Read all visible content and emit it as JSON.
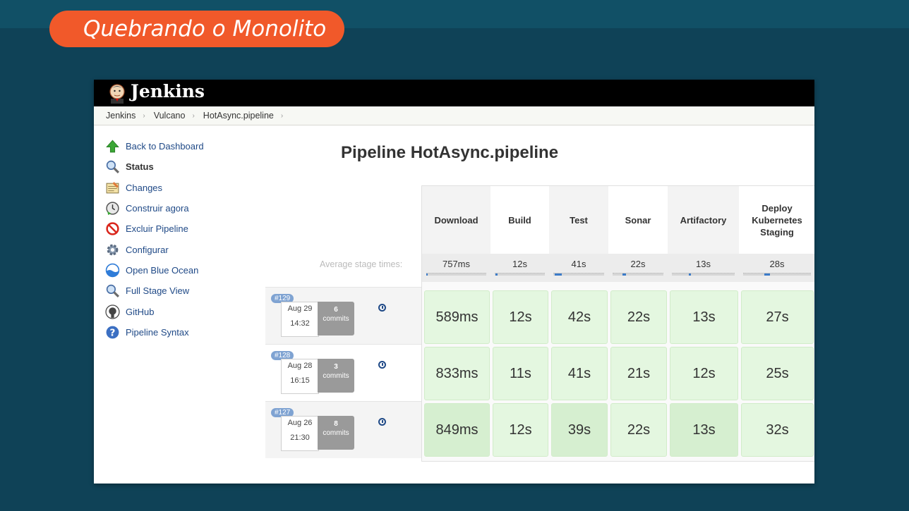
{
  "slide": {
    "title": "Quebrando o Monolito"
  },
  "jenkins": {
    "app_name": "Jenkins",
    "breadcrumbs": [
      "Jenkins",
      "Vulcano",
      "HotAsync.pipeline"
    ],
    "sidebar": [
      {
        "label": "Back to Dashboard",
        "icon": "arrow-up-icon"
      },
      {
        "label": "Status",
        "icon": "magnifier-icon"
      },
      {
        "label": "Changes",
        "icon": "notepad-icon"
      },
      {
        "label": "Construir agora",
        "icon": "clock-build-icon"
      },
      {
        "label": "Excluir Pipeline",
        "icon": "no-entry-icon"
      },
      {
        "label": "Configurar",
        "icon": "gear-icon"
      },
      {
        "label": "Open Blue Ocean",
        "icon": "blue-ocean-icon"
      },
      {
        "label": "Full Stage View",
        "icon": "magnifier-icon"
      },
      {
        "label": "GitHub",
        "icon": "github-icon"
      },
      {
        "label": "Pipeline Syntax",
        "icon": "help-icon"
      }
    ],
    "page_title": "Pipeline HotAsync.pipeline",
    "avg_label": "Average stage times:",
    "stages": [
      {
        "name": "Download",
        "avg": "757ms"
      },
      {
        "name": "Build",
        "avg": "12s"
      },
      {
        "name": "Test",
        "avg": "41s"
      },
      {
        "name": "Sonar",
        "avg": "22s"
      },
      {
        "name": "Artifactory",
        "avg": "13s"
      },
      {
        "name": "Deploy Kubernetes Staging",
        "avg": "28s"
      }
    ],
    "runs": [
      {
        "id": "#129",
        "date": "Aug 29",
        "time": "14:32",
        "commits": "6",
        "commits_label": "commits",
        "durations": [
          "589ms",
          "12s",
          "42s",
          "22s",
          "13s",
          "27s"
        ]
      },
      {
        "id": "#128",
        "date": "Aug 28",
        "time": "16:15",
        "commits": "3",
        "commits_label": "commits",
        "durations": [
          "833ms",
          "11s",
          "41s",
          "21s",
          "12s",
          "25s"
        ]
      },
      {
        "id": "#127",
        "date": "Aug 26",
        "time": "21:30",
        "commits": "8",
        "commits_label": "commits",
        "durations": [
          "849ms",
          "12s",
          "39s",
          "22s",
          "13s",
          "32s"
        ]
      }
    ]
  }
}
